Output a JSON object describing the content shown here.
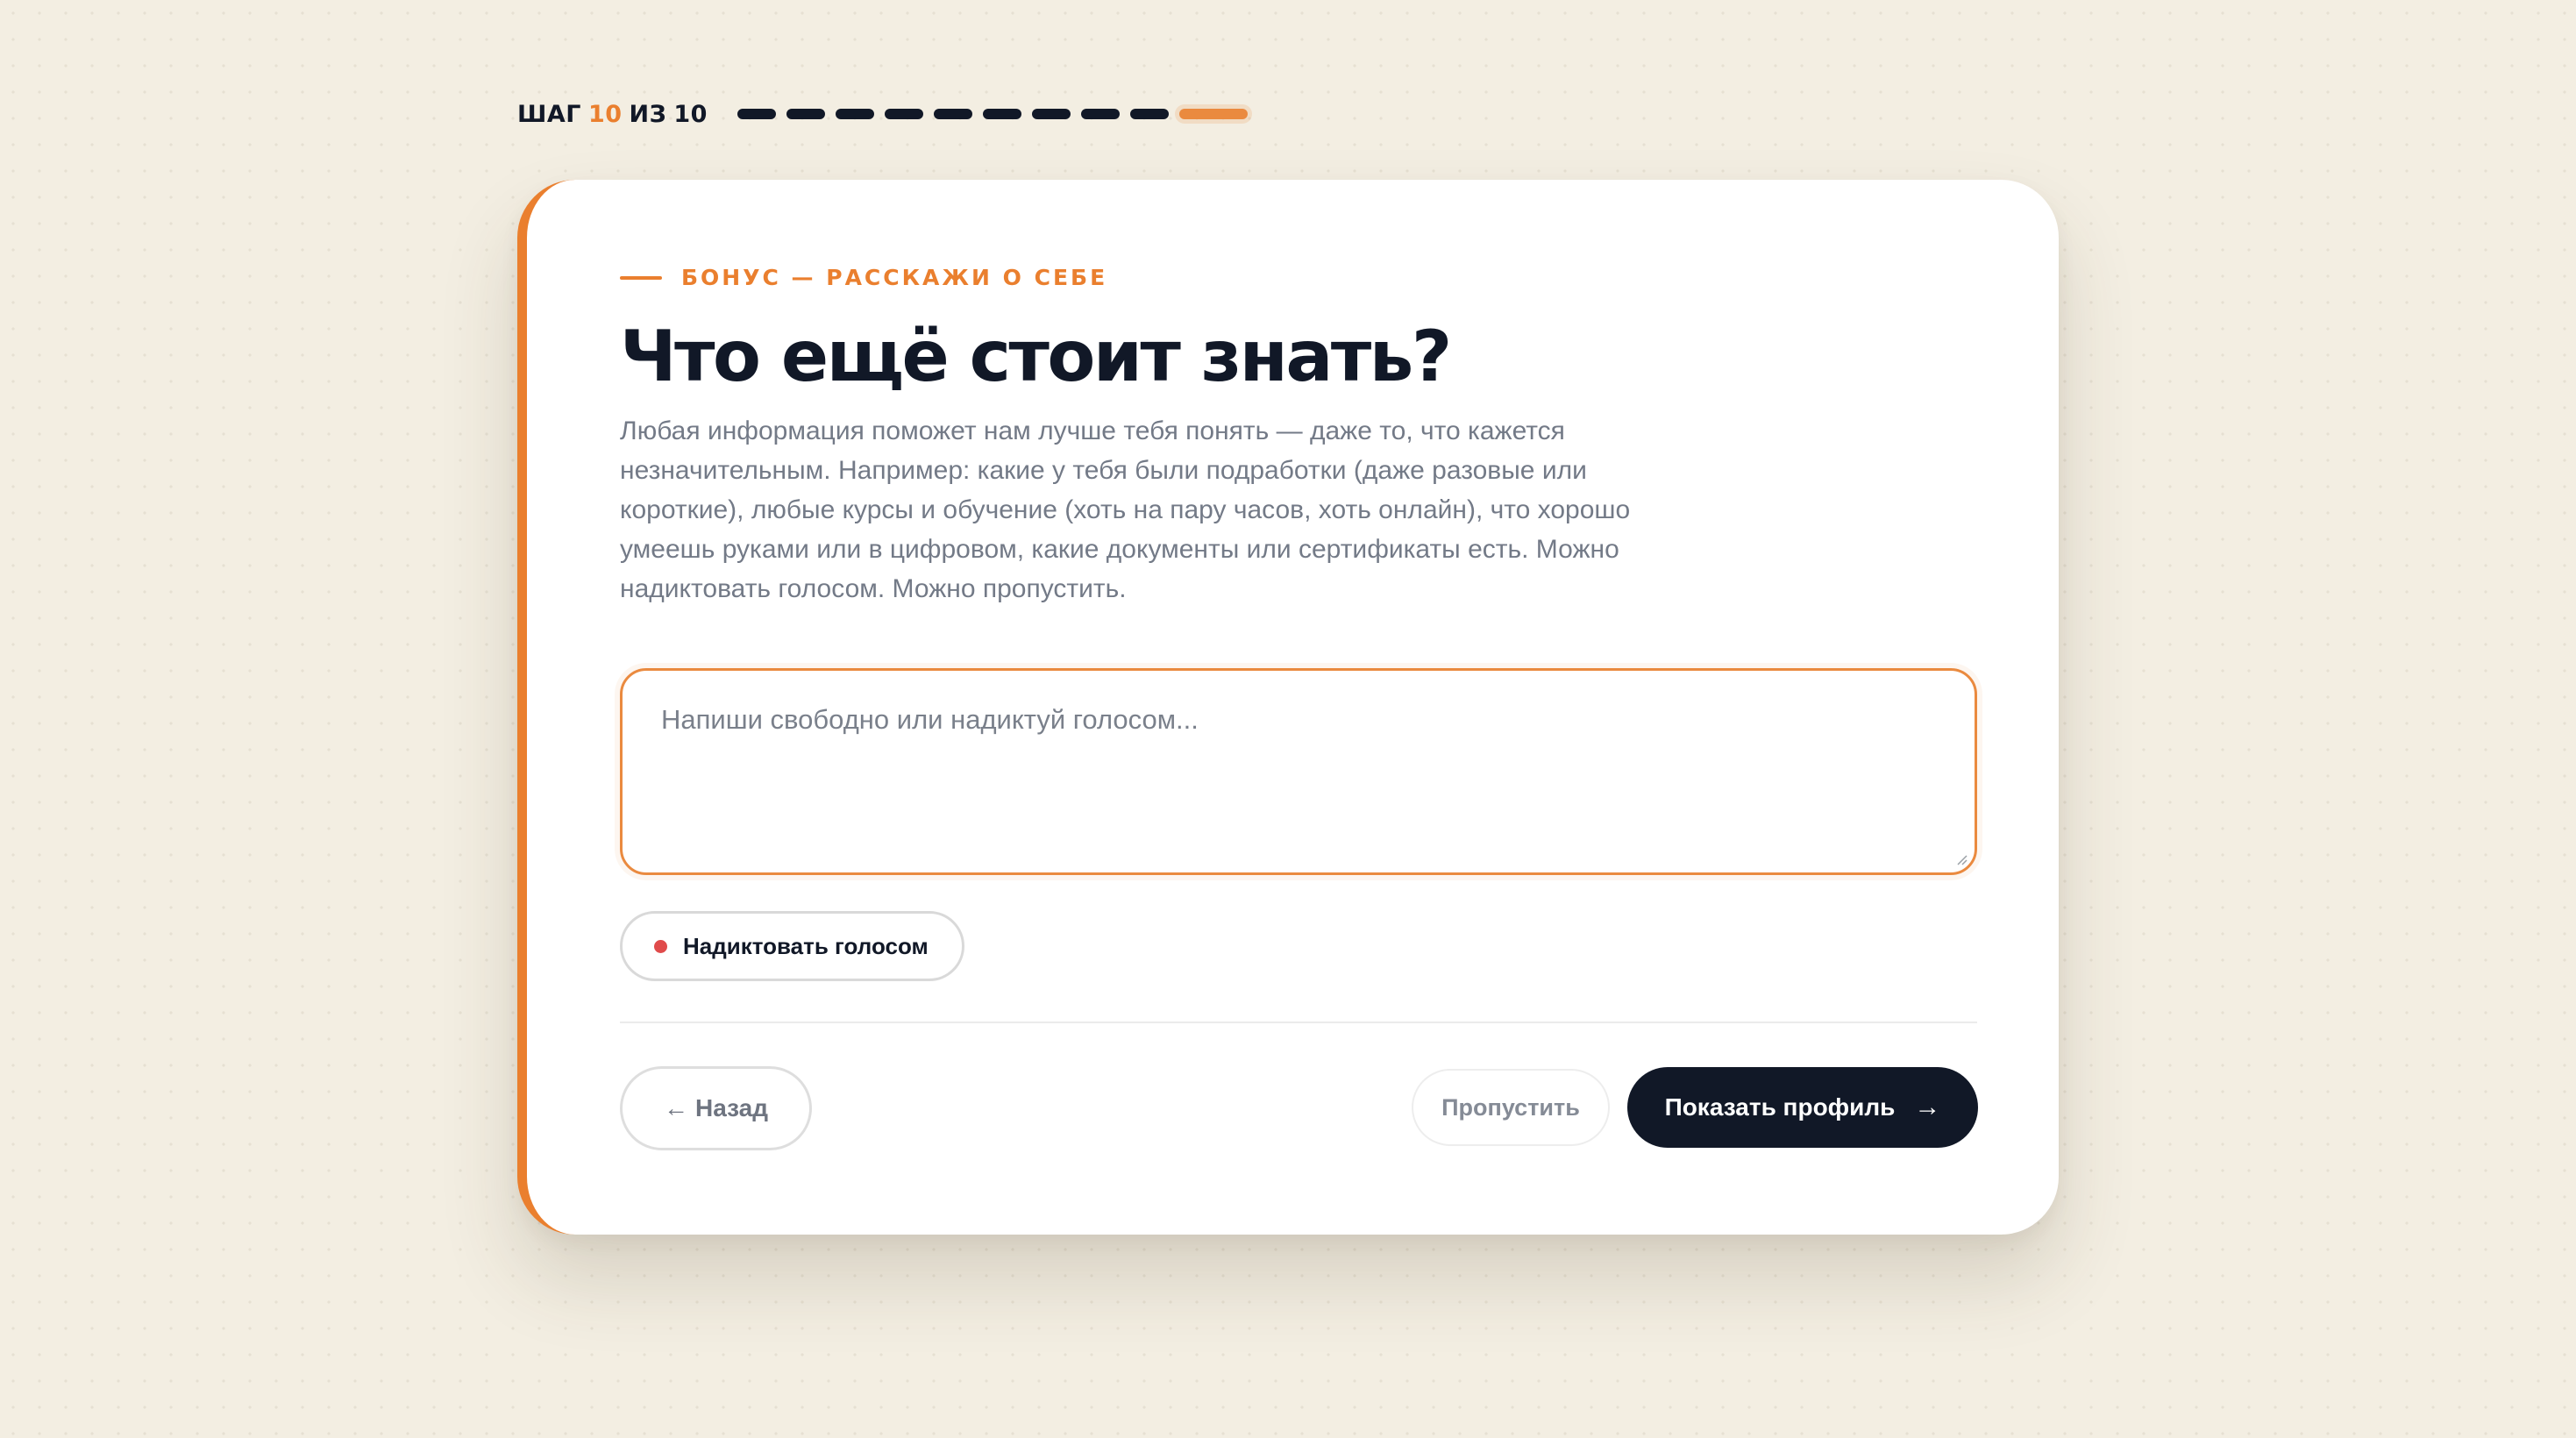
{
  "progress": {
    "step_word": "ШАГ",
    "current": "10",
    "of_word": "ИЗ",
    "total": "10",
    "completed_steps": 9,
    "active_step": 10
  },
  "colors": {
    "accent": "#ea7f2e",
    "dark": "#111827",
    "background": "#f3eee2",
    "record": "#e04b4b"
  },
  "card": {
    "eyebrow": "БОНУС — РАССКАЖИ О СЕБЕ",
    "title": "Что ещё стоит знать?",
    "description": "Любая информация поможет нам лучше тебя понять — даже то, что кажется незначительным. Например: какие у тебя были подработки (даже разовые или короткие), любые курсы и обучение (хоть на пару часов, хоть онлайн), что хорошо умеешь руками или в цифровом, какие документы или сертификаты есть. Можно надиктовать голосом. Можно пропустить.",
    "input": {
      "value": "",
      "placeholder": "Напиши свободно или надиктуй голосом..."
    },
    "voice_button": "Надиктовать голосом"
  },
  "footer": {
    "back_arrow": "←",
    "back_label": "Назад",
    "skip_label": "Пропустить",
    "primary_label": "Показать профиль",
    "primary_arrow": "→"
  }
}
